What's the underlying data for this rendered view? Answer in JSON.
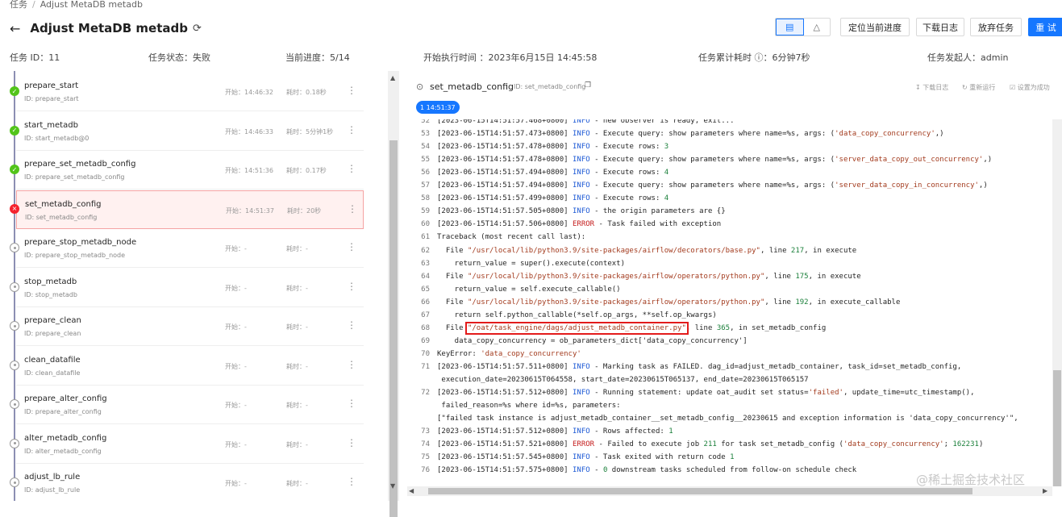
{
  "breadcrumb": {
    "root": "任务",
    "separator": "/",
    "current": "Adjust MetaDB metadb"
  },
  "header": {
    "title": "Adjust MetaDB metadb",
    "view_list_icon": "list-view-icon",
    "view_graph_icon": "graph-view-icon",
    "buttons": {
      "locate": "定位当前进度",
      "download": "下载日志",
      "abandon": "放弃任务",
      "retry": "重 试"
    }
  },
  "info": {
    "task_id": "任务 ID：11",
    "status": "任务状态：失败",
    "progress": "当前进度：5/14",
    "start_time": "开始执行时间 ：2023年6月15日 14:45:58",
    "elapsed": "任务累计耗时 ⓘ：6分钟7秒",
    "initiator": "任务发起人：admin"
  },
  "tasks": [
    {
      "name": "prepare_start",
      "id": "ID: prepare_start",
      "start": "开始：14:46:32",
      "duration": "耗时：0.18秒",
      "status": "success"
    },
    {
      "name": "start_metadb",
      "id": "ID: start_metadb@0",
      "start": "开始：14:46:33",
      "duration": "耗时：5分钟1秒",
      "status": "success"
    },
    {
      "name": "prepare_set_metadb_config",
      "id": "ID: prepare_set_metadb_config",
      "start": "开始：14:51:36",
      "duration": "耗时：0.17秒",
      "status": "success"
    },
    {
      "name": "set_metadb_config",
      "id": "ID: set_metadb_config",
      "start": "开始：14:51:37",
      "duration": "耗时：20秒",
      "status": "failed"
    },
    {
      "name": "prepare_stop_metadb_node",
      "id": "ID: prepare_stop_metadb_node",
      "start": "开始：-",
      "duration": "耗时：-",
      "status": "pending"
    },
    {
      "name": "stop_metadb",
      "id": "ID: stop_metadb",
      "start": "开始：-",
      "duration": "耗时：-",
      "status": "pending"
    },
    {
      "name": "prepare_clean",
      "id": "ID: prepare_clean",
      "start": "开始：-",
      "duration": "耗时：-",
      "status": "pending"
    },
    {
      "name": "clean_datafile",
      "id": "ID: clean_datafile",
      "start": "开始：-",
      "duration": "耗时：-",
      "status": "pending"
    },
    {
      "name": "prepare_alter_config",
      "id": "ID: prepare_alter_config",
      "start": "开始：-",
      "duration": "耗时：-",
      "status": "pending"
    },
    {
      "name": "alter_metadb_config",
      "id": "ID: alter_metadb_config",
      "start": "开始：-",
      "duration": "耗时：-",
      "status": "pending"
    },
    {
      "name": "adjust_lb_rule",
      "id": "ID: adjust_lb_rule",
      "start": "开始：-",
      "duration": "耗时：-",
      "status": "pending"
    }
  ],
  "log_panel": {
    "task_name": "set_metadb_config",
    "task_id": "ID: set_metadb_config",
    "actions": {
      "download": "下载日志",
      "rerun": "重新运行",
      "set_success": "设置为成功"
    },
    "attempt_tag": "1 14:51:37",
    "lines": [
      {
        "no": "52",
        "ts": "[2023-06-15T14:51:57.468+0800]",
        "level": "INFO",
        "msg": " - new observer is ready, exit..."
      },
      {
        "no": "53",
        "ts": "[2023-06-15T14:51:57.473+0800]",
        "level": "INFO",
        "msg": " - Execute query: show parameters where name=%s, args: (",
        "str": "'data_copy_concurrency'",
        "tail": ",)"
      },
      {
        "no": "54",
        "ts": "[2023-06-15T14:51:57.478+0800]",
        "level": "INFO",
        "msg": " - Execute rows: ",
        "num": "3"
      },
      {
        "no": "55",
        "ts": "[2023-06-15T14:51:57.478+0800]",
        "level": "INFO",
        "msg": " - Execute query: show parameters where name=%s, args: (",
        "str": "'server_data_copy_out_concurrency'",
        "tail": ",)"
      },
      {
        "no": "56",
        "ts": "[2023-06-15T14:51:57.494+0800]",
        "level": "INFO",
        "msg": " - Execute rows: ",
        "num": "4"
      },
      {
        "no": "57",
        "ts": "[2023-06-15T14:51:57.494+0800]",
        "level": "INFO",
        "msg": " - Execute query: show parameters where name=%s, args: (",
        "str": "'server_data_copy_in_concurrency'",
        "tail": ",)"
      },
      {
        "no": "58",
        "ts": "[2023-06-15T14:51:57.499+0800]",
        "level": "INFO",
        "msg": " - Execute rows: ",
        "num": "4"
      },
      {
        "no": "59",
        "ts": "[2023-06-15T14:51:57.505+0800]",
        "level": "INFO",
        "msg": " - the origin parameters are {}"
      },
      {
        "no": "60",
        "ts": "[2023-06-15T14:51:57.506+0800]",
        "level": "ERROR",
        "msg": " - Task failed with exception"
      },
      {
        "no": "61",
        "text": "Traceback (most recent call last):"
      },
      {
        "no": "62",
        "pre": "  File ",
        "str": "\"/usr/local/lib/python3.9/site-packages/airflow/decorators/base.py\"",
        "mid": ", line ",
        "num": "217",
        "tail": ", in execute"
      },
      {
        "no": "63",
        "text": "    return_value = super().execute(context)"
      },
      {
        "no": "64",
        "pre": "  File ",
        "str": "\"/usr/local/lib/python3.9/site-packages/airflow/operators/python.py\"",
        "mid": ", line ",
        "num": "175",
        "tail": ", in execute"
      },
      {
        "no": "65",
        "text": "    return_value = self.execute_callable()"
      },
      {
        "no": "66",
        "pre": "  File ",
        "str": "\"/usr/local/lib/python3.9/site-packages/airflow/operators/python.py\"",
        "mid": ", line ",
        "num": "192",
        "tail": ", in execute_callable"
      },
      {
        "no": "67",
        "text": "    return self.python_callable(*self.op_args, **self.op_kwargs)"
      },
      {
        "no": "68",
        "pre": "  File ",
        "str": "\"/oat/task_engine/dags/adjust_metadb_container.py\"",
        "mid": ", line ",
        "num": "365",
        "tail": ", in set_metadb_config",
        "boxed": true
      },
      {
        "no": "69",
        "text": "    data_copy_concurrency = ob_parameters_dict['data_copy_concurrency']"
      },
      {
        "no": "70",
        "pre": "KeyError: ",
        "str": "'data_copy_concurrency'"
      },
      {
        "no": "71",
        "ts": "[2023-06-15T14:51:57.511+0800]",
        "level": "INFO",
        "msg": " - Marking task as FAILED. dag_id=adjust_metadb_container, task_id=set_metadb_config,"
      },
      {
        "no": "",
        "text": " execution_date=20230615T064558, start_date=20230615T065137, end_date=20230615T065157"
      },
      {
        "no": "72",
        "ts": "[2023-06-15T14:51:57.512+0800]",
        "level": "INFO",
        "msg": " - Running statement: update oat_audit set status=",
        "str": "'failed'",
        "tail": ", update_time=utc_timestamp(),"
      },
      {
        "no": "",
        "text": " failed_reason=%s where id=%s, parameters:"
      },
      {
        "no": "",
        "text": "[\"failed task instance is adjust_metadb_container__set_metadb_config__20230615 and exception information is 'data_copy_concurrency'\","
      },
      {
        "no": "73",
        "ts": "[2023-06-15T14:51:57.512+0800]",
        "level": "INFO",
        "msg": " - Rows affected: ",
        "num": "1"
      },
      {
        "no": "74",
        "ts": "[2023-06-15T14:51:57.521+0800]",
        "level": "ERROR",
        "msg": " - Failed to execute job ",
        "num": "211",
        "tail": " for task set_metadb_config (",
        "str2": "'data_copy_concurrency'",
        "tail2": "; ",
        "num2": "162231",
        "tail3": ")"
      },
      {
        "no": "75",
        "ts": "[2023-06-15T14:51:57.545+0800]",
        "level": "INFO",
        "msg": " - Task exited with return code ",
        "num": "1"
      },
      {
        "no": "76",
        "ts": "[2023-06-15T14:51:57.575+0800]",
        "level": "INFO",
        "msg": " - ",
        "num": "0",
        "tail": " downstream tasks scheduled from follow-on schedule check"
      }
    ]
  },
  "watermark": "@稀土掘金技术社区",
  "colors": {
    "primary": "#1677ff",
    "success": "#52c41a",
    "failed": "#f5222d",
    "info_level": "#1f5bd6",
    "error_level": "#c41d1d"
  }
}
